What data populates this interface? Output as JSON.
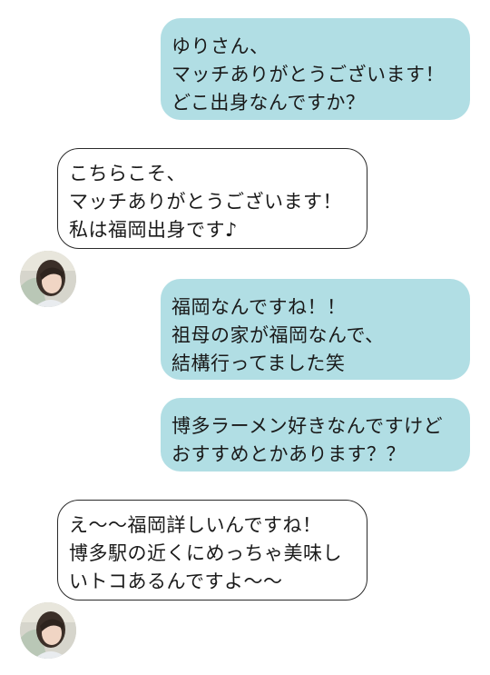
{
  "messages": [
    {
      "direction": "sent",
      "lines": [
        "ゆりさん、",
        "マッチありがとうございます！",
        "どこ出身なんですか？"
      ]
    },
    {
      "direction": "received",
      "lines": [
        "こちらこそ、",
        "マッチありがとうございます！",
        "私は福岡出身です♪"
      ]
    },
    {
      "direction": "sent",
      "lines": [
        "福岡なんですね！！",
        "祖母の家が福岡なんで、",
        "結構行ってました笑"
      ]
    },
    {
      "direction": "sent",
      "lines": [
        "博多ラーメン好きなんですけど",
        "おすすめとかあります？？"
      ]
    },
    {
      "direction": "received",
      "lines": [
        "え〜〜福岡詳しいんですね！",
        "博多駅の近くにめっちゃ美味し",
        "いトコあるんですよ〜〜"
      ]
    }
  ],
  "colors": {
    "sent_bubble": "#b1dee4",
    "received_border": "#2a2a2a",
    "text": "#1a1a1a"
  },
  "icons": {
    "avatar": "profile-photo-avatar"
  }
}
